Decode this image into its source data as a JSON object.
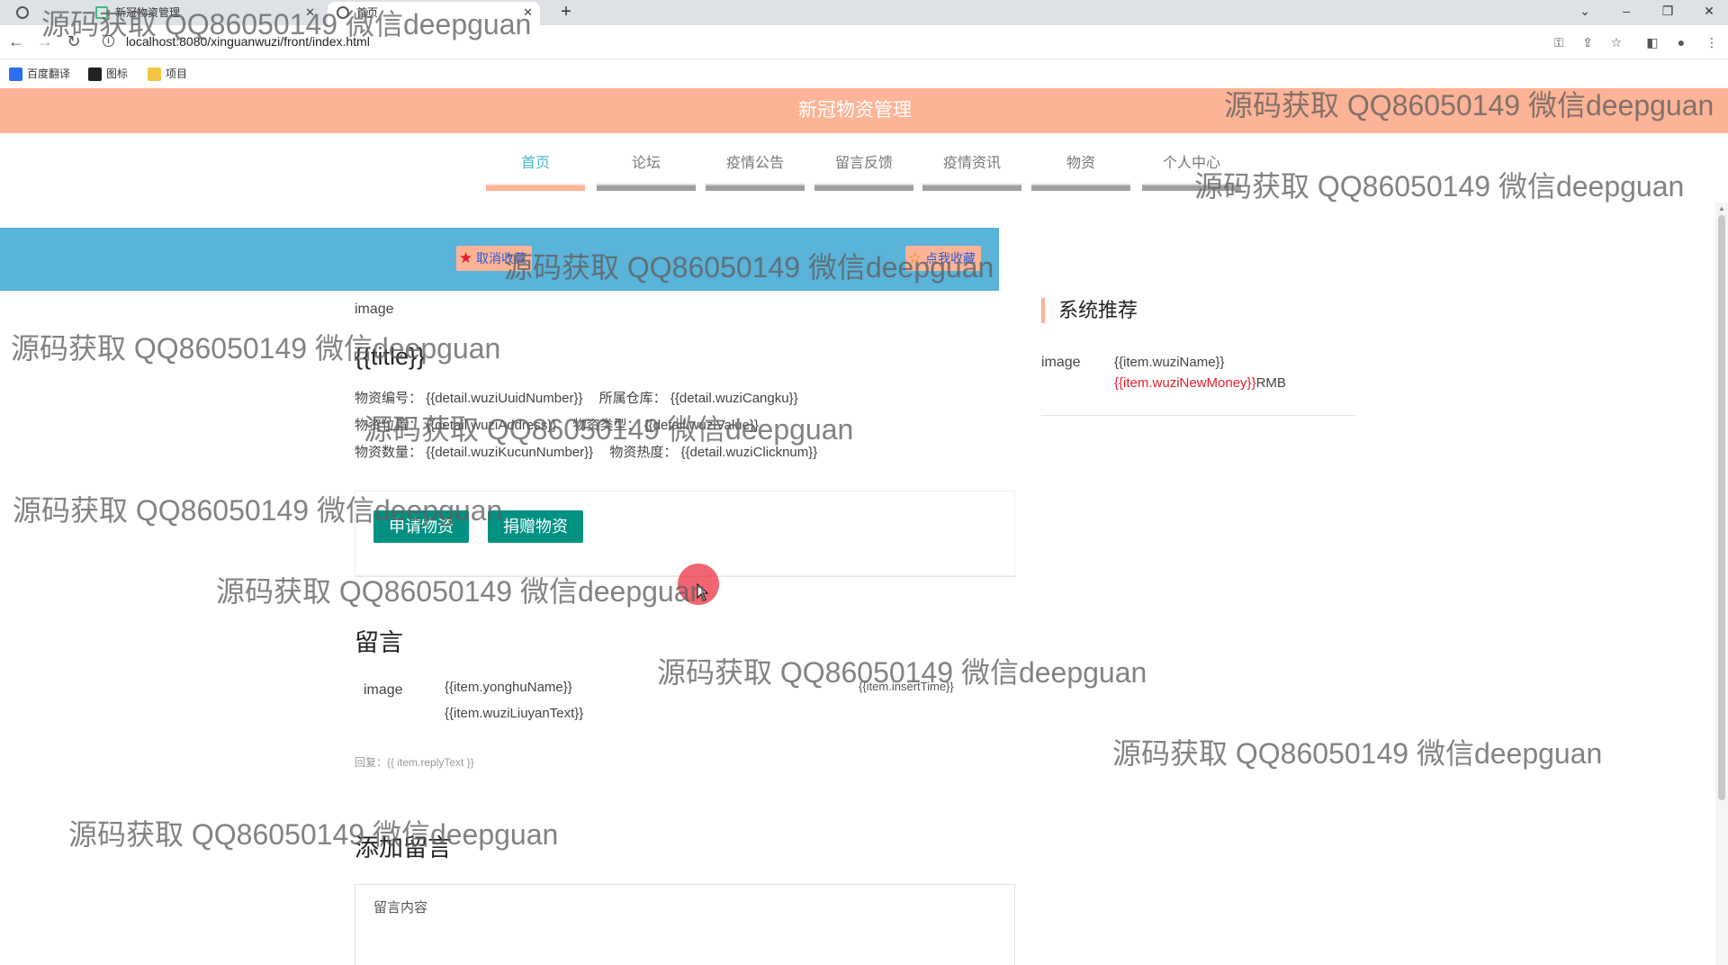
{
  "browser": {
    "tabs": [
      {
        "title": ""
      },
      {
        "title": "新冠物资管理"
      },
      {
        "title": "首页"
      }
    ],
    "new_tab": "+",
    "window_controls": {
      "collapse": "⌄",
      "minimize": "–",
      "restore": "❐",
      "close": "✕"
    },
    "url": "localhost:8080/xinguanwuzi/front/index.html",
    "bookmarks": [
      {
        "label": "百度翻译",
        "color": "#2a6ef1"
      },
      {
        "label": "图标",
        "color": "#222222"
      },
      {
        "label": "项目",
        "color": "#f4c542"
      }
    ]
  },
  "header": {
    "title": "新冠物资管理",
    "color": "#fdb396"
  },
  "nav": {
    "items": [
      {
        "label": "首页"
      },
      {
        "label": "论坛"
      },
      {
        "label": "疫情公告"
      },
      {
        "label": "留言反馈"
      },
      {
        "label": "疫情资讯"
      },
      {
        "label": "物资"
      },
      {
        "label": "个人中心"
      }
    ]
  },
  "favorite": {
    "cancel_label": "取消收藏",
    "add_label": "点我收藏"
  },
  "detail": {
    "image_alt": "image",
    "title": "{{title}}",
    "row1": {
      "label1": "物资编号：",
      "value1": "{{detail.wuziUuidNumber}}",
      "label2": "所属仓库：",
      "value2": "{{detail.wuziCangku}}"
    },
    "row2": {
      "label1": "物资位置：",
      "value1": "{{detail.wuziAddress}}",
      "label2": "物资类型：",
      "value2": "{{detail.wuziValue}}"
    },
    "row3": {
      "label1": "物资数量：",
      "value1": "{{detail.wuziKucunNumber}}",
      "label2": "物资热度：",
      "value2": "{{detail.wuziClicknum}}"
    }
  },
  "actions": {
    "apply_label": "申请物资",
    "donate_label": "捐赠物资",
    "color": "#009183"
  },
  "comments": {
    "title": "留言",
    "avatar_alt": "image",
    "user": "{{item.yonghuName}}",
    "text": "{{item.wuziLiuyanText}}",
    "time": "{{item.insertTime}}",
    "reply": "回复：{{ item.replyText }}"
  },
  "add_comment": {
    "title": "添加留言",
    "placeholder": "留言内容"
  },
  "recommend": {
    "title": "系统推荐",
    "image_alt": "image",
    "name": "{{item.wuziName}}",
    "price": "{{item.wuziNewMoney}}",
    "currency": "RMB"
  },
  "watermark": "源码获取 QQ86050149 微信deepguan"
}
